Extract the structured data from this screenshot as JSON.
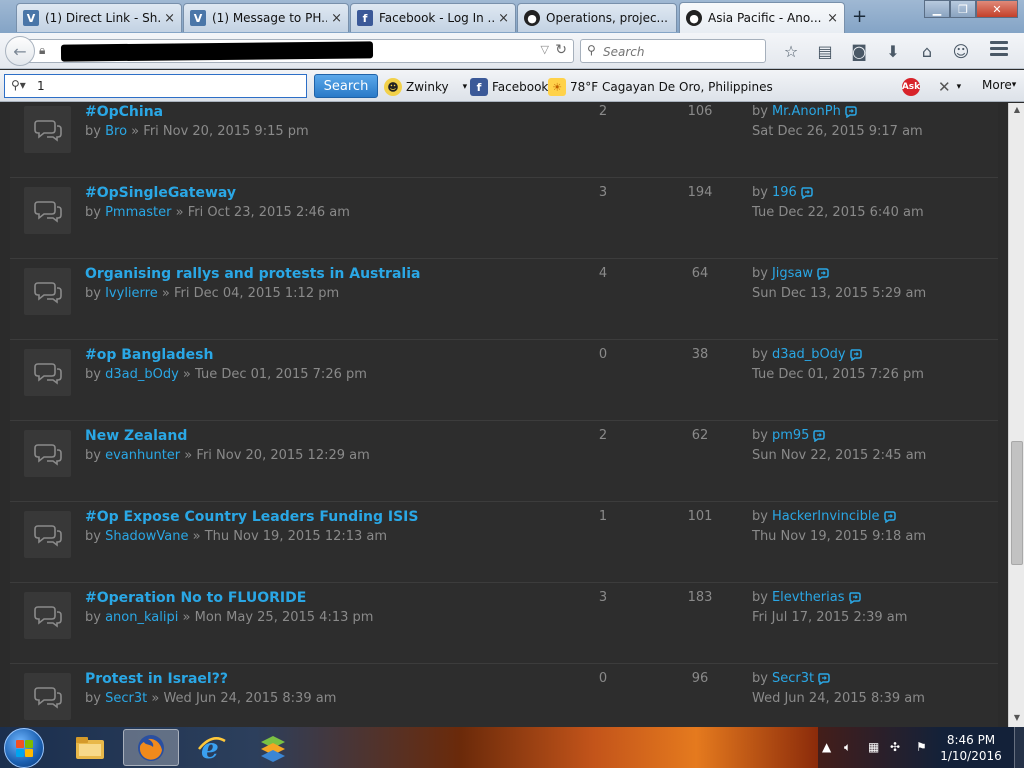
{
  "tabs": [
    {
      "label": "(1) Direct Link - Sh...",
      "icon": "vk-icon"
    },
    {
      "label": "(1) Message to PH...",
      "icon": "vk-icon"
    },
    {
      "label": "Facebook - Log In ...",
      "icon": "facebook-icon"
    },
    {
      "label": "Operations, projec...",
      "icon": "anon-icon"
    },
    {
      "label": "Asia Pacific - Ano...",
      "icon": "anon-icon",
      "active": true
    }
  ],
  "nav": {
    "search_placeholder": "Search"
  },
  "toolbar": {
    "search_value": "1",
    "search_button": "Search",
    "zwinky": "Zwinky",
    "facebook": "Facebook",
    "weather": "78°F Cagayan De Oro, Philippines",
    "more": "More"
  },
  "topics": [
    {
      "title": "#OpChina",
      "author": "Bro",
      "posted": "Fri Nov 20, 2015 9:15 pm",
      "replies": "2",
      "views": "106",
      "last_by": "Mr.AnonPh",
      "last_date": "Sat Dec 26, 2015 9:17 am"
    },
    {
      "title": "#OpSingleGateway",
      "author": "Pmmaster",
      "posted": "Fri Oct 23, 2015 2:46 am",
      "replies": "3",
      "views": "194",
      "last_by": "196",
      "last_date": "Tue Dec 22, 2015 6:40 am"
    },
    {
      "title": "Organising rallys and protests in Australia",
      "author": "Ivylierre",
      "posted": "Fri Dec 04, 2015 1:12 pm",
      "replies": "4",
      "views": "64",
      "last_by": "Jigsaw",
      "last_date": "Sun Dec 13, 2015 5:29 am"
    },
    {
      "title": "#op Bangladesh",
      "author": "d3ad_bOdy",
      "posted": "Tue Dec 01, 2015 7:26 pm",
      "replies": "0",
      "views": "38",
      "last_by": "d3ad_bOdy",
      "last_date": "Tue Dec 01, 2015 7:26 pm"
    },
    {
      "title": "New Zealand",
      "author": "evanhunter",
      "posted": "Fri Nov 20, 2015 12:29 am",
      "replies": "2",
      "views": "62",
      "last_by": "pm95",
      "last_date": "Sun Nov 22, 2015 2:45 am"
    },
    {
      "title": "#Op Expose Country Leaders Funding ISIS",
      "author": "ShadowVane",
      "posted": "Thu Nov 19, 2015 12:13 am",
      "replies": "1",
      "views": "101",
      "last_by": "HackerInvincible",
      "last_date": "Thu Nov 19, 2015 9:18 am"
    },
    {
      "title": "#Operation No to FLUORIDE",
      "author": "anon_kalipi",
      "posted": "Mon May 25, 2015 4:13 pm",
      "replies": "3",
      "views": "183",
      "last_by": "Elevtherias",
      "last_date": "Fri Jul 17, 2015 2:39 am"
    },
    {
      "title": "Protest in Israel??",
      "author": "Secr3t",
      "posted": "Wed Jun 24, 2015 8:39 am",
      "replies": "0",
      "views": "96",
      "last_by": "Secr3t",
      "last_date": "Wed Jun 24, 2015 8:39 am"
    }
  ],
  "strings": {
    "by": "by",
    "sep": "»"
  },
  "clock": {
    "time": "8:46 PM",
    "date": "1/10/2016"
  },
  "colors": {
    "link": "#2aa7e5",
    "panel": "#2d2d2d",
    "meta": "#8a8a8a"
  }
}
